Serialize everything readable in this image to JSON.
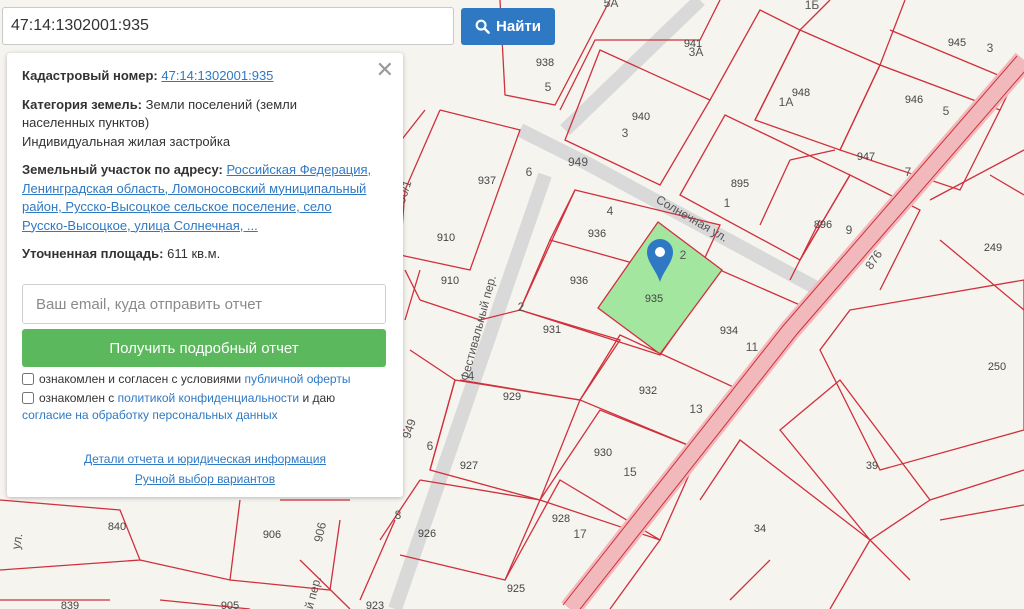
{
  "search": {
    "value": "47:14:1302001:935",
    "button_label": "Найти"
  },
  "panel": {
    "cadastral_label": "Кадастровый номер:",
    "cadastral_value": "47:14:1302001:935",
    "category_label": "Категория земель:",
    "category_value": "Земли поселений (земли населенных пунктов)",
    "usage_value": "Индивидуальная жилая застройка",
    "address_label": "Земельный участок по адресу:",
    "address_value": "Российская Федерация, Ленинградская область, Ломоносовский муниципальный район, Русско-Высоцкое сельское поселение, село Русско-Высоцкое, улица Солнечная, ...",
    "area_label": "Уточненная площадь:",
    "area_value": "611 кв.м.",
    "email_placeholder": "Ваш email, куда отправить отчет",
    "report_button": "Получить подробный отчет",
    "consent1_text": "ознакомлен и согласен с условиями",
    "consent1_link": "публичной оферты",
    "consent2_text": "ознакомлен с",
    "consent2_link1": "политикой конфиденциальности",
    "consent2_and": "и даю",
    "consent2_link2": "согласие на обработку персональных данных",
    "details_link": "Детали отчета и юридическая информация",
    "manual_link": "Ручной выбор вариантов"
  },
  "map": {
    "plot_labels": [
      "938",
      "941",
      "945",
      "948",
      "946",
      "940",
      "947",
      "937",
      "895",
      "936",
      "896",
      "910",
      "936",
      "935",
      "249",
      "910",
      "934",
      "931",
      "250",
      "929",
      "932",
      "39",
      "927",
      "930",
      "928",
      "840",
      "906",
      "926",
      "34",
      "839",
      "905",
      "923",
      "925"
    ],
    "house_numbers": [
      "5А",
      "1Б",
      "3",
      "3А",
      "5",
      "1А",
      "5",
      "3",
      "6",
      "7",
      "1",
      "4",
      "9",
      "2",
      "2",
      "11",
      "4",
      "13",
      "15",
      "6",
      "17",
      "8"
    ],
    "street_labels": [
      "Солнечная ул.",
      "Фестивальный пер.",
      "949",
      "949",
      "906",
      "876",
      "90/1",
      "ул.",
      "ный пер."
    ],
    "colors": {
      "plot_border": "#d0303c",
      "selected_fill": "#a3e6a0",
      "highway": "#f2b9bc",
      "marker": "#2f79c4"
    }
  }
}
